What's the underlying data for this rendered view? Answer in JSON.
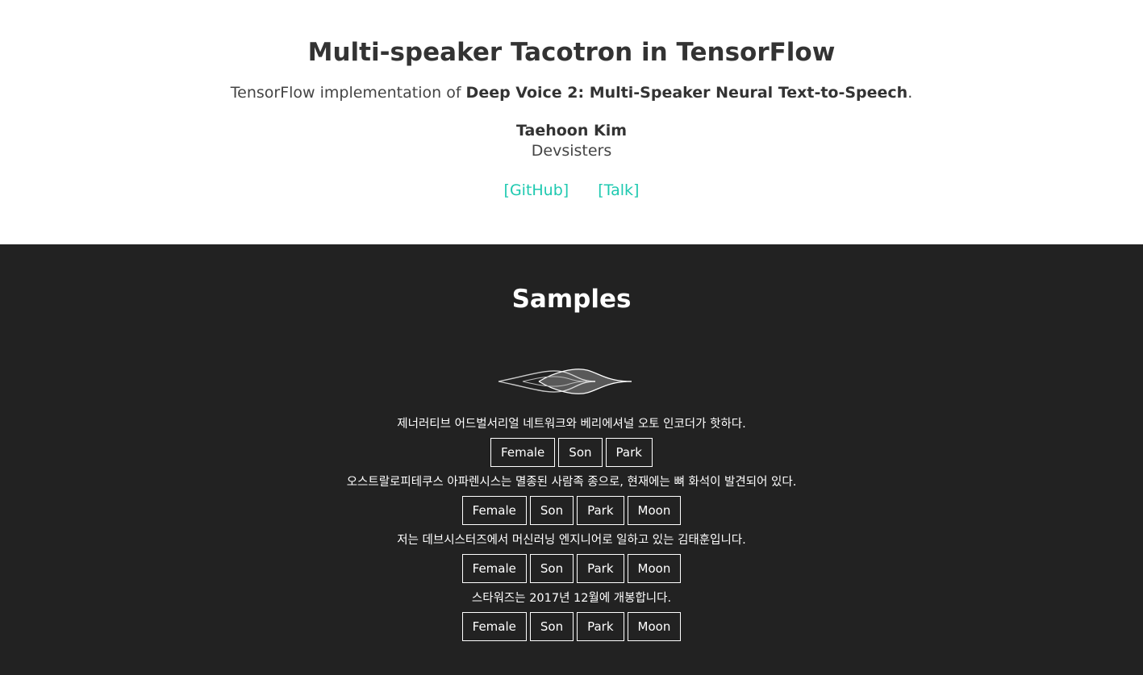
{
  "hero": {
    "title": "Multi-speaker Tacotron in TensorFlow",
    "subtitle_prefix": "TensorFlow implementation of ",
    "subtitle_bold": "Deep Voice 2: Multi-Speaker Neural Text-to-Speech",
    "subtitle_suffix": ".",
    "author": "Taehoon Kim",
    "affiliation": "Devsisters",
    "links": {
      "github": "[GitHub]",
      "talk": "[Talk]"
    },
    "link_color": "#1ec9b0"
  },
  "samples": {
    "heading": "Samples",
    "icon": "waveform-icon",
    "items": [
      {
        "sentence": "제너러티브 어드벌서리얼 네트워크와 베리에셔널 오토 인코더가 핫하다.",
        "buttons": [
          "Female",
          "Son",
          "Park"
        ]
      },
      {
        "sentence": "오스트랄로피테쿠스 아파렌시스는 멸종된 사람족 종으로, 현재에는 뼈 화석이 발견되어 있다.",
        "buttons": [
          "Female",
          "Son",
          "Park",
          "Moon"
        ]
      },
      {
        "sentence": "저는 데브시스터즈에서 머신러닝 엔지니어로 일하고 있는 김태훈입니다.",
        "buttons": [
          "Female",
          "Son",
          "Park",
          "Moon"
        ]
      },
      {
        "sentence": "스타워즈는 2017년 12월에 개봉합니다.",
        "buttons": [
          "Female",
          "Son",
          "Park",
          "Moon"
        ]
      }
    ]
  }
}
